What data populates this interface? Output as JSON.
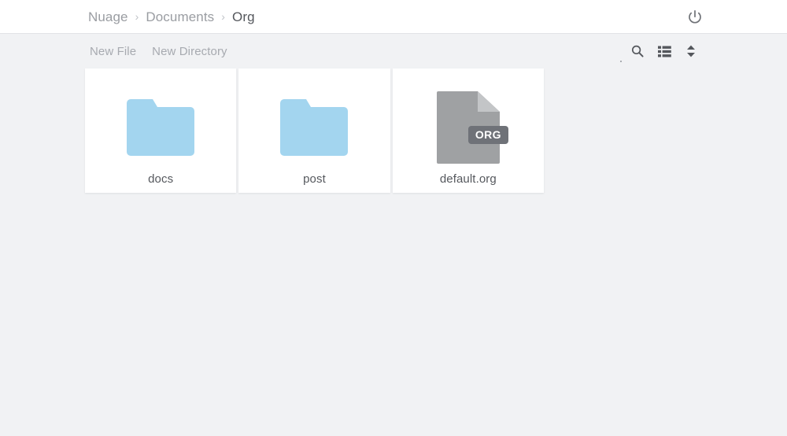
{
  "app": {
    "name": "Nuage"
  },
  "header": {
    "breadcrumb": [
      {
        "label": "Nuage",
        "current": false
      },
      {
        "label": "Documents",
        "current": false
      },
      {
        "label": "Org",
        "current": true
      }
    ],
    "separator": "›",
    "logout_icon": "power-icon"
  },
  "toolbar": {
    "new_file_label": "New File",
    "new_directory_label": "New Directory",
    "search_icon": "search-icon",
    "view_list_icon": "list-view-icon",
    "sort_icon": "sort-icon"
  },
  "files": [
    {
      "name": "docs",
      "type": "folder",
      "icon": "folder-icon",
      "color": "#a3d5ef"
    },
    {
      "name": "post",
      "type": "folder",
      "icon": "folder-icon",
      "color": "#a3d5ef"
    },
    {
      "name": "default.org",
      "type": "file",
      "icon": "file-icon",
      "extension": "ORG",
      "color": "#9fa1a3",
      "badge_color": "#6f7278"
    }
  ],
  "colors": {
    "page_background": "#f1f2f4",
    "card_background": "#ffffff",
    "header_background": "#ffffff",
    "text_primary": "#55585d",
    "text_muted": "#a7aab0",
    "folder_blue": "#a3d5ef",
    "file_gray": "#9fa1a3"
  }
}
